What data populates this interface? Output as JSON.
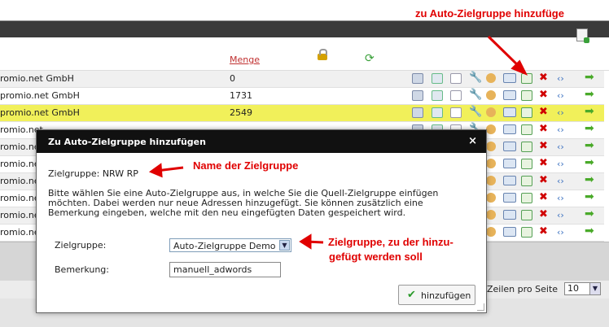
{
  "annotations": {
    "top": "zu Auto-Zielgruppe hinzufüge",
    "name": "Name der Zielgruppe",
    "zielgruppe_line1": "Zielgruppe, zu der hinzu-",
    "zielgruppe_line2": "gefügt werden soll"
  },
  "grid": {
    "col_menge": "Menge",
    "rows": [
      {
        "name": "romio.net GmbH",
        "count": "0"
      },
      {
        "name": "promio.net GmbH",
        "count": "1731"
      },
      {
        "name": "promio.net GmbH",
        "count": "2549"
      },
      {
        "name": "romio.net",
        "count": ""
      },
      {
        "name": "romio.net",
        "count": ""
      },
      {
        "name": "romio.net",
        "count": ""
      },
      {
        "name": "romio.net",
        "count": ""
      },
      {
        "name": "romio.net",
        "count": ""
      },
      {
        "name": "romio.net",
        "count": ""
      },
      {
        "name": "romio.net GmbH",
        "count": ""
      }
    ]
  },
  "pager": {
    "label": "Zeilen pro Seite",
    "value": "10"
  },
  "dialog": {
    "title": "Zu Auto-Zielgruppe hinzufügen",
    "close": "×",
    "zielgruppe_line": "Zielgruppe: NRW RP",
    "desc_line1": "Bitte wählen Sie eine Auto-Zielgruppe aus, in welche Sie die Quell-Zielgruppe einfügen",
    "desc_line2": "möchten. Dabei werden nur neue Adressen hinzugefügt. Sie können zusätzlich eine",
    "desc_line3": "Bemerkung eingeben, welche mit den neu eingefügten Daten gespeichert wird.",
    "label_zielgruppe": "Zielgruppe:",
    "select_value": "Auto-Zielgruppe Demo",
    "label_bemerkung": "Bemerkung:",
    "bemerkung_value": "manuell_adwords",
    "button": "hinzufügen"
  },
  "colors": {
    "highlight_row": "#f1f05a",
    "annotation": "#e00000",
    "title_bar": "#111111"
  }
}
